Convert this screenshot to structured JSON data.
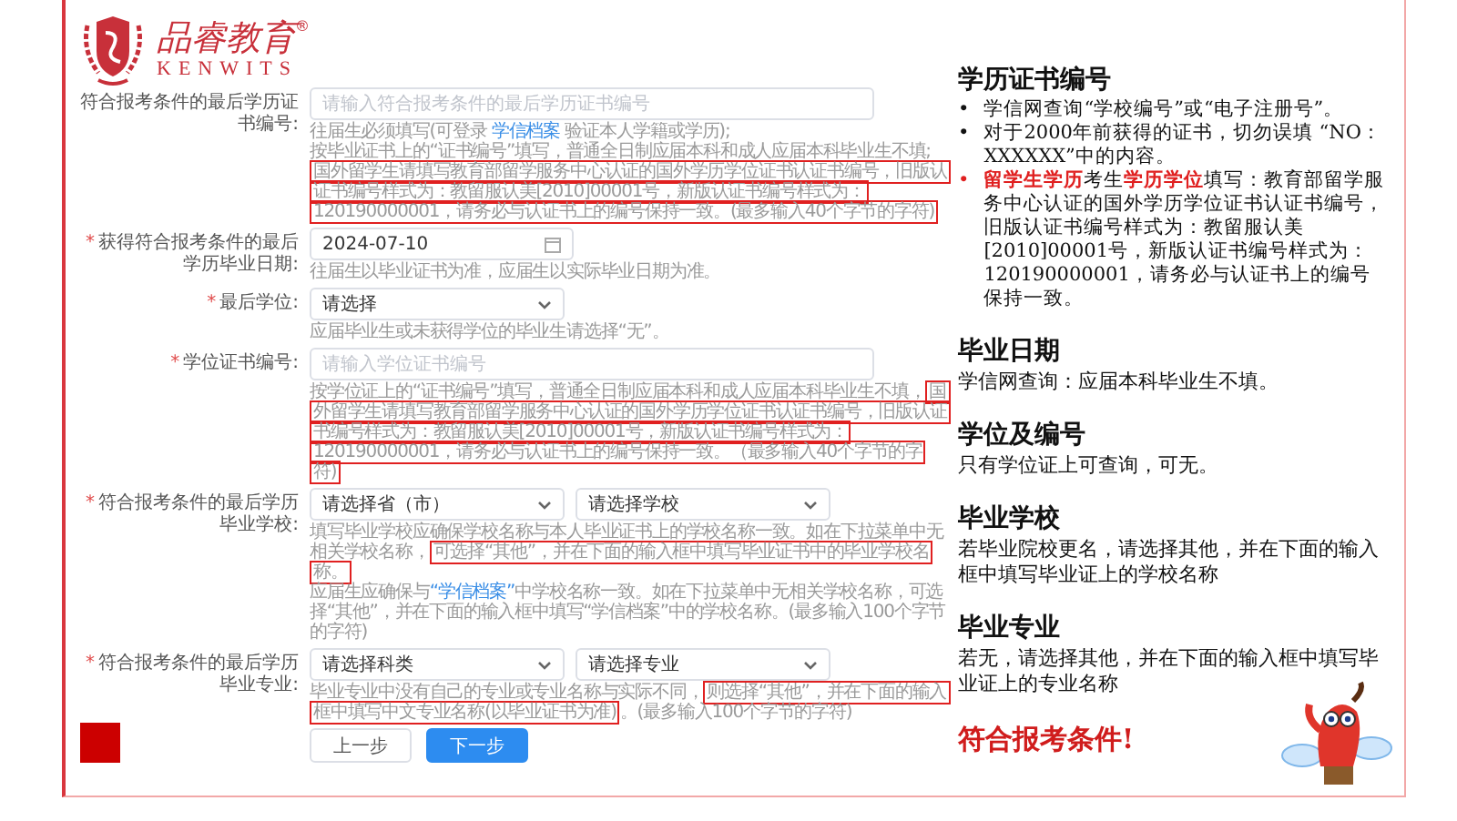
{
  "logo": {
    "name": "品睿教育",
    "mark": "®",
    "latin": "KENWITS"
  },
  "form": {
    "fields": [
      {
        "label": "符合报考条件的最后学历证书编号:",
        "controls": [
          {
            "kind": "input",
            "placeholder": "请输入符合报考条件的最后学历证书编号"
          }
        ],
        "hints": [
          [
            {
              "kind": "plain",
              "text": "往届生必须填写(可登录 "
            },
            {
              "kind": "link",
              "text": "学信档案"
            },
            {
              "kind": "plain",
              "text": " 验证本人学籍或学历);"
            }
          ],
          [
            {
              "kind": "plain",
              "text": "按毕业证书上的“证书编号”填写，普通全日制应届本科和成人应届本科毕业生不填;"
            }
          ],
          [
            {
              "kind": "boxed",
              "text": "国外留学生请填写教育部留学服务中心认证的国外学历学位证书认证书编号，旧版认证书编号样式为：教留服认美[2010]00001号，新版认证书编号样式为：120190000001，请务必与认证书上的编号保持一致。(最多输入40个字节的字符)"
            }
          ]
        ]
      },
      {
        "label": "获得符合报考条件的最后学历毕业日期:",
        "required_mark": "*",
        "controls": [
          {
            "kind": "date",
            "value": "2024-07-10"
          }
        ],
        "hints": [
          [
            {
              "kind": "plain",
              "text": "往届生以毕业证书为准，应届生以实际毕业日期为准。"
            }
          ]
        ]
      },
      {
        "label": "最后学位:",
        "required_mark": "*",
        "controls": [
          {
            "kind": "select",
            "value": "请选择"
          }
        ],
        "hints": [
          [
            {
              "kind": "plain",
              "text": "应届毕业生或未获得学位的毕业生请选择“无”。"
            }
          ]
        ]
      },
      {
        "label": "学位证书编号:",
        "required_mark": "*",
        "controls": [
          {
            "kind": "input",
            "placeholder": "请输入学位证书编号"
          }
        ],
        "hints": [
          [
            {
              "kind": "plain",
              "text": "按学位证上的“证书编号”填写，普通全日制应届本科和成人应届本科毕业生不填，"
            },
            {
              "kind": "boxed",
              "text": "国外留学生请填写教育部留学服务中心认证的国外学历学位证书认证书编号，旧版认证书编号样式为：教留服认美[2010]00001号，新版认证书编号样式为：120190000001，请务必与认证书上的编号保持一致。（最多输入40个字节的字符)"
            }
          ]
        ]
      },
      {
        "label": "符合报考条件的最后学历毕业学校:",
        "required_mark": "*",
        "controls": [
          {
            "kind": "select",
            "value": "请选择省（市）"
          },
          {
            "kind": "select",
            "value": "请选择学校"
          }
        ],
        "hints": [
          [
            {
              "kind": "plain",
              "text": "填写毕业学校应确保学校名称与本人毕业证书上的学校名称一致。如在下拉菜单中无相关学校名称，"
            },
            {
              "kind": "boxed",
              "text": "可选择“其他”，并在下面的输入框中填写毕业证书中的毕业学校名称。"
            }
          ],
          [
            {
              "kind": "plain",
              "text": "应届生应确保与"
            },
            {
              "kind": "link",
              "text": "“学信档案”"
            },
            {
              "kind": "plain",
              "text": "中学校名称一致。如在下拉菜单中无相关学校名称，可选择“其他”，并在下面的输入框中填写“学信档案”中的学校名称。(最多输入100个字节的字符)"
            }
          ]
        ]
      },
      {
        "label": "符合报考条件的最后学历毕业专业:",
        "required_mark": "*",
        "controls": [
          {
            "kind": "select",
            "value": "请选择科类"
          },
          {
            "kind": "select",
            "value": "请选择专业"
          }
        ],
        "hints": [
          [
            {
              "kind": "plain",
              "text": "毕业专业中没有自己的专业或专业名称与实际不同，"
            },
            {
              "kind": "boxed",
              "text": "则选择“其他”，并在下面的输入框中填写中文专业名称(以毕业证书为准)"
            },
            {
              "kind": "plain",
              "text": "。(最多输入100个字节的字符)"
            }
          ]
        ]
      }
    ],
    "buttons": [
      {
        "label": "上一步",
        "primary": false
      },
      {
        "label": "下一步",
        "primary": true
      }
    ]
  },
  "notes": [
    {
      "kind": "bullets",
      "heading": "学历证书编号",
      "bullets": [
        {
          "marker": "•",
          "segments": [
            {
              "text": "学信网查询“学校编号”或“电子注册号”。",
              "highlight": false
            }
          ]
        },
        {
          "marker": "•",
          "segments": [
            {
              "text": "对于2000年前获得的证书，切勿误填 “NO：XXXXXX”中的内容。",
              "highlight": false
            }
          ]
        },
        {
          "marker": "•",
          "segments": [
            {
              "text": "留学生学历",
              "highlight": true
            },
            {
              "text": "考生",
              "highlight": false
            },
            {
              "text": "学历学位",
              "highlight": true
            },
            {
              "text": "填写：教育部留学服务中心认证的国外学历学位证书认证书编号，旧版认证书编号样式为：教留服认美[2010]00001号，新版认证书编号样式为：120190000001，请务必与认证书上的编号保持一致。",
              "highlight": false
            }
          ]
        }
      ]
    },
    {
      "kind": "text",
      "heading": "毕业日期",
      "text": "学信网查询：应届本科毕业生不填。"
    },
    {
      "kind": "text",
      "heading": "学位及编号",
      "text": "只有学位证上可查询，可无。"
    },
    {
      "kind": "text",
      "heading": "毕业学校",
      "text": "若毕业院校更名，请选择其他，并在下面的输入框中填写毕业证上的学校名称"
    },
    {
      "kind": "text",
      "heading": "毕业专业",
      "text": "若无，请选择其他，并在下面的输入框中填写毕业证上的专业名称"
    },
    {
      "kind": "conclusion",
      "text": "符合报考条件!"
    }
  ]
}
